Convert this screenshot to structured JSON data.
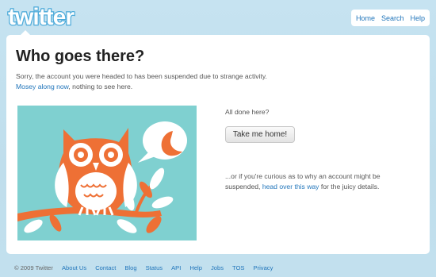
{
  "brand": {
    "logo_text": "twitter"
  },
  "topnav": {
    "items": [
      "Home",
      "Search",
      "Help"
    ]
  },
  "page": {
    "title": "Who goes there?",
    "message": "Sorry, the account you were headed to has been suspended due to strange activity.",
    "mosey_link": "Mosey along now",
    "mosey_suffix": ", nothing to see here."
  },
  "side": {
    "all_done": "All done here?",
    "home_button": "Take me home!",
    "curious_prefix": "...or if you're curious as to why an account might be suspended,",
    "curious_link": "head over this way",
    "curious_suffix": "for the juicy details."
  },
  "art": {
    "icon": "owl-illustration",
    "bg_color": "#7fd0d0",
    "accent_color": "#ee7035"
  },
  "footer": {
    "copyright": "© 2009 Twitter",
    "links": [
      "About Us",
      "Contact",
      "Blog",
      "Status",
      "API",
      "Help",
      "Jobs",
      "TOS",
      "Privacy"
    ]
  },
  "colors": {
    "link": "#2276bb",
    "background": "#c0deed"
  }
}
